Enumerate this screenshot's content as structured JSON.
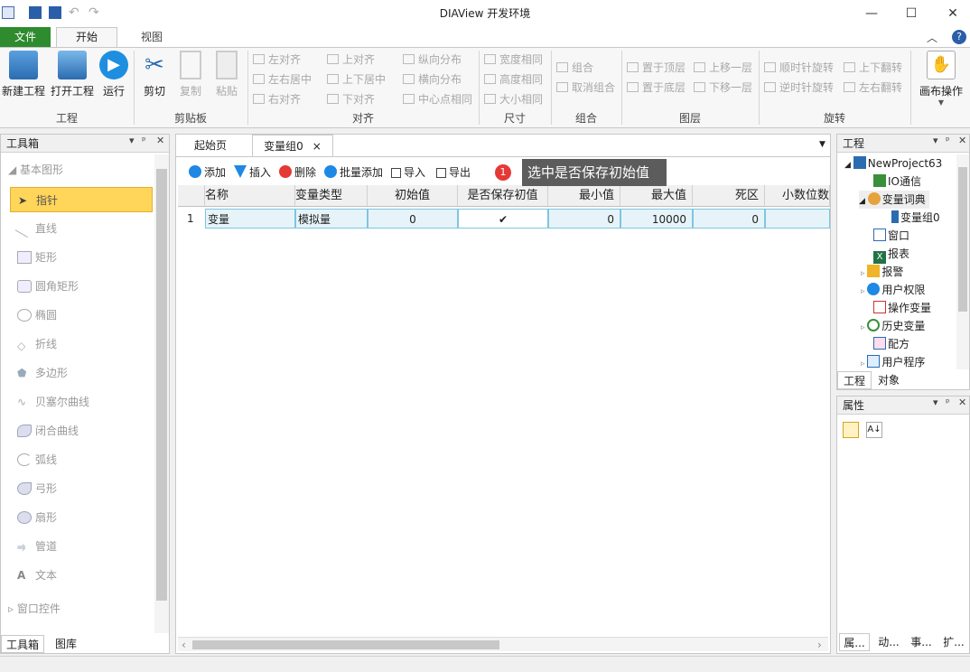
{
  "window": {
    "title": "DIAView 开发环境"
  },
  "menu": {
    "file": "文件",
    "home": "开始",
    "view": "视图"
  },
  "ribbon": {
    "project": {
      "label": "工程",
      "new": "新建工程",
      "open": "打开工程",
      "run": "运行"
    },
    "clipboard": {
      "label": "剪贴板",
      "cut": "剪切",
      "copy": "复制",
      "paste": "粘贴"
    },
    "align": {
      "label": "对齐",
      "items": [
        "左对齐",
        "左右居中",
        "右对齐",
        "上对齐",
        "上下居中",
        "下对齐",
        "纵向分布",
        "横向分布",
        "中心点相同"
      ]
    },
    "size": {
      "label": "尺寸",
      "items": [
        "宽度相同",
        "高度相同",
        "大小相同"
      ]
    },
    "group": {
      "label": "组合",
      "items": [
        "组合",
        "取消组合"
      ]
    },
    "layer": {
      "label": "图层",
      "items": [
        "置于顶层",
        "置于底层",
        "上移一层",
        "下移一层"
      ]
    },
    "rotate": {
      "label": "旋转",
      "items": [
        "顺时针旋转",
        "逆时针旋转",
        "上下翻转",
        "左右翻转"
      ]
    },
    "canvas": {
      "label": "画布操作"
    }
  },
  "toolbox": {
    "title": "工具箱",
    "section": "基本图形",
    "items": [
      "指针",
      "直线",
      "矩形",
      "圆角矩形",
      "椭圆",
      "折线",
      "多边形",
      "贝塞尔曲线",
      "闭合曲线",
      "弧线",
      "弓形",
      "扇形",
      "管道",
      "文本"
    ],
    "section2": "窗口控件",
    "tabs": [
      "工具箱",
      "图库"
    ]
  },
  "doc": {
    "tabs": [
      "起始页",
      "变量组0"
    ],
    "toolbar": [
      "添加",
      "插入",
      "删除",
      "批量添加",
      "导入",
      "导出"
    ],
    "columns": [
      "名称",
      "变量类型",
      "初始值",
      "是否保存初值",
      "最小值",
      "最大值",
      "死区",
      "小数位数"
    ],
    "rows": [
      {
        "index": "1",
        "name": "变量",
        "type": "模拟量",
        "init": "0",
        "save": "✔",
        "min": "0",
        "max": "10000",
        "dead": "0"
      }
    ]
  },
  "hint": {
    "badge": "1",
    "text": "选中是否保存初始值"
  },
  "project": {
    "title": "工程",
    "root": "NewProject63",
    "items": [
      "IO通信",
      "变量词典",
      "变量组0",
      "窗口",
      "报表",
      "报警",
      "用户权限",
      "操作变量",
      "历史变量",
      "配方",
      "用户程序"
    ],
    "tabs": [
      "工程",
      "对象"
    ]
  },
  "properties": {
    "title": "属性",
    "tabs": [
      "属...",
      "动...",
      "事...",
      "扩..."
    ]
  },
  "colors": {
    "file_tab": "#2e8b2e",
    "selection": "#fff3a0",
    "row": "#e6f4f9"
  }
}
